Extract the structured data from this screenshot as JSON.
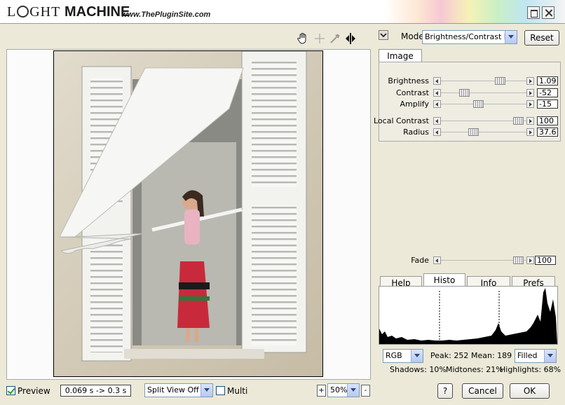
{
  "titlebar": {
    "logo_prefix": "L",
    "logo_suffix": "GHT",
    "logo_machine": "MACHINE",
    "website": "www.ThePluginSite.com"
  },
  "mode": {
    "label": "Mode",
    "selected": "Brightness/Contrast Pro",
    "reset_label": "Reset"
  },
  "image_tab": {
    "label": "Image"
  },
  "sliders": [
    {
      "label": "Brightness",
      "value": "1.09",
      "thumb_fraction": 0.72
    },
    {
      "label": "Contrast",
      "value": "-52",
      "thumb_fraction": 0.24
    },
    {
      "label": "Amplify",
      "value": "-15",
      "thumb_fraction": 0.43
    },
    {
      "label": "Local Contrast",
      "value": "100",
      "thumb_fraction": 0.96
    },
    {
      "label": "Radius",
      "value": "37.6",
      "thumb_fraction": 0.36
    }
  ],
  "fade": {
    "label": "Fade",
    "value": "100",
    "thumb_fraction": 0.96
  },
  "bottom_tabs": [
    "Help",
    "Histo",
    "Info",
    "Prefs"
  ],
  "histo": {
    "channel": "RGB",
    "peak": "Peak: 252",
    "mean": "Mean: 189",
    "style": "Filled",
    "shadows": "Shadows: 10%",
    "midtones": "Midtones: 21%",
    "highlights": "Highlights: 68%"
  },
  "bottom_bar": {
    "preview_label": "Preview",
    "timing": "0.069 s -> 0.3 s",
    "split_view": "Split View Off",
    "multi_label": "Multi",
    "zoom": "50%",
    "zoom_plus": "+",
    "zoom_minus": "-"
  },
  "dialog": {
    "help": "?",
    "cancel": "Cancel",
    "ok": "OK"
  },
  "icons": [
    "hand-icon",
    "crosshair-icon",
    "eyedropper-icon",
    "split-arrows-icon",
    "collapse-arrow-icon"
  ]
}
